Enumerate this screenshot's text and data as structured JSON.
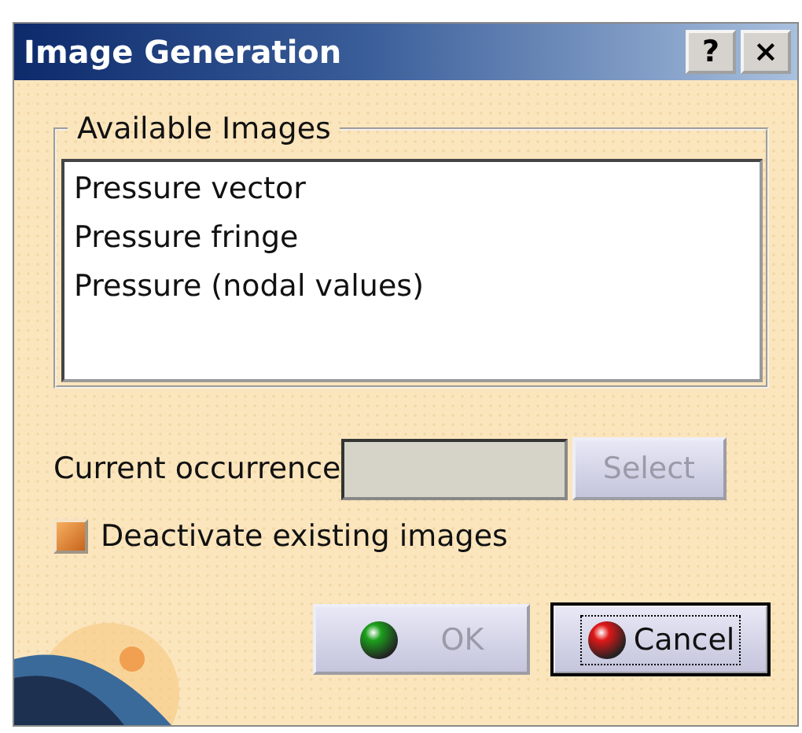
{
  "window": {
    "title": "Image Generation",
    "title_buttons": [
      "?",
      "×"
    ]
  },
  "available_images": {
    "legend": "Available Images",
    "items": [
      {
        "label": "Pressure vector",
        "selected": false
      },
      {
        "label": "Pressure fringe",
        "selected": false
      },
      {
        "label": "Pressure (nodal values)",
        "selected": false
      }
    ]
  },
  "current_occurrence": {
    "label": "Current occurrence",
    "disabled": true,
    "select_button": {
      "label": "Select",
      "disabled": true
    }
  },
  "deactivate_checkbox": {
    "label": "Deactivate existing images",
    "checked": true
  },
  "buttons": [
    {
      "kind": "ok",
      "label": "OK",
      "disabled": true,
      "focused": false
    },
    {
      "kind": "cancel",
      "label": "Cancel",
      "disabled": false,
      "focused": true
    }
  ]
}
